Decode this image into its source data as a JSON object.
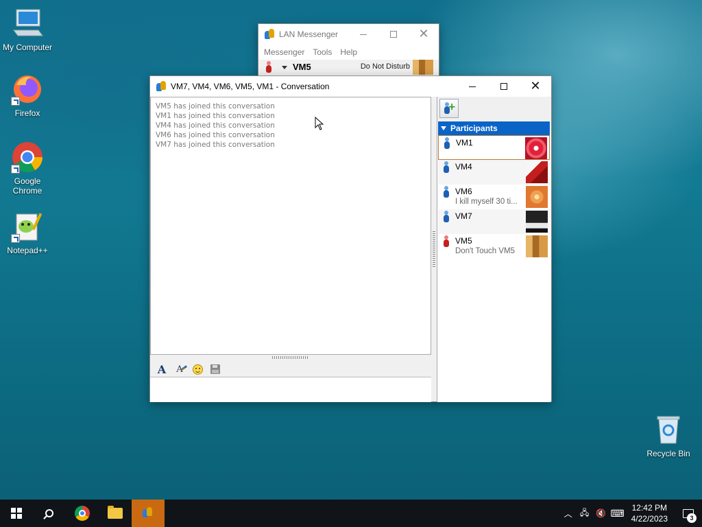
{
  "desktop": {
    "icons": [
      {
        "label": "My Computer"
      },
      {
        "label": "Firefox"
      },
      {
        "label": "Google Chrome"
      },
      {
        "label": "Notepad++"
      },
      {
        "label": "Recycle Bin"
      }
    ]
  },
  "lan_messenger": {
    "title": "LAN Messenger",
    "menu": [
      "Messenger",
      "Tools",
      "Help"
    ],
    "user": {
      "name": "VM5",
      "status": "Do Not Disturb"
    }
  },
  "conversation": {
    "title": "VM7, VM4, VM6, VM5, VM1 - Conversation",
    "messages": [
      "VM5 has joined this conversation",
      "VM1 has joined this conversation",
      "VM4 has joined this conversation",
      "VM6 has joined this conversation",
      "VM7 has joined this conversation"
    ],
    "participants_header": "Participants",
    "participants": [
      {
        "name": "VM1",
        "status": "",
        "color": "blue"
      },
      {
        "name": "VM4",
        "status": "",
        "color": "blue"
      },
      {
        "name": "VM6",
        "status": "I kill myself 30 ti...",
        "color": "blue"
      },
      {
        "name": "VM7",
        "status": "",
        "color": "blue"
      },
      {
        "name": "VM5",
        "status": "Don't Touch VM5",
        "color": "red"
      }
    ]
  },
  "taskbar": {
    "time": "12:42 PM",
    "date": "4/22/2023",
    "notification_count": "3"
  },
  "colors": {
    "participants_header": "#0a64c8",
    "taskbar": "#101418",
    "active_task": "#c96a12"
  }
}
